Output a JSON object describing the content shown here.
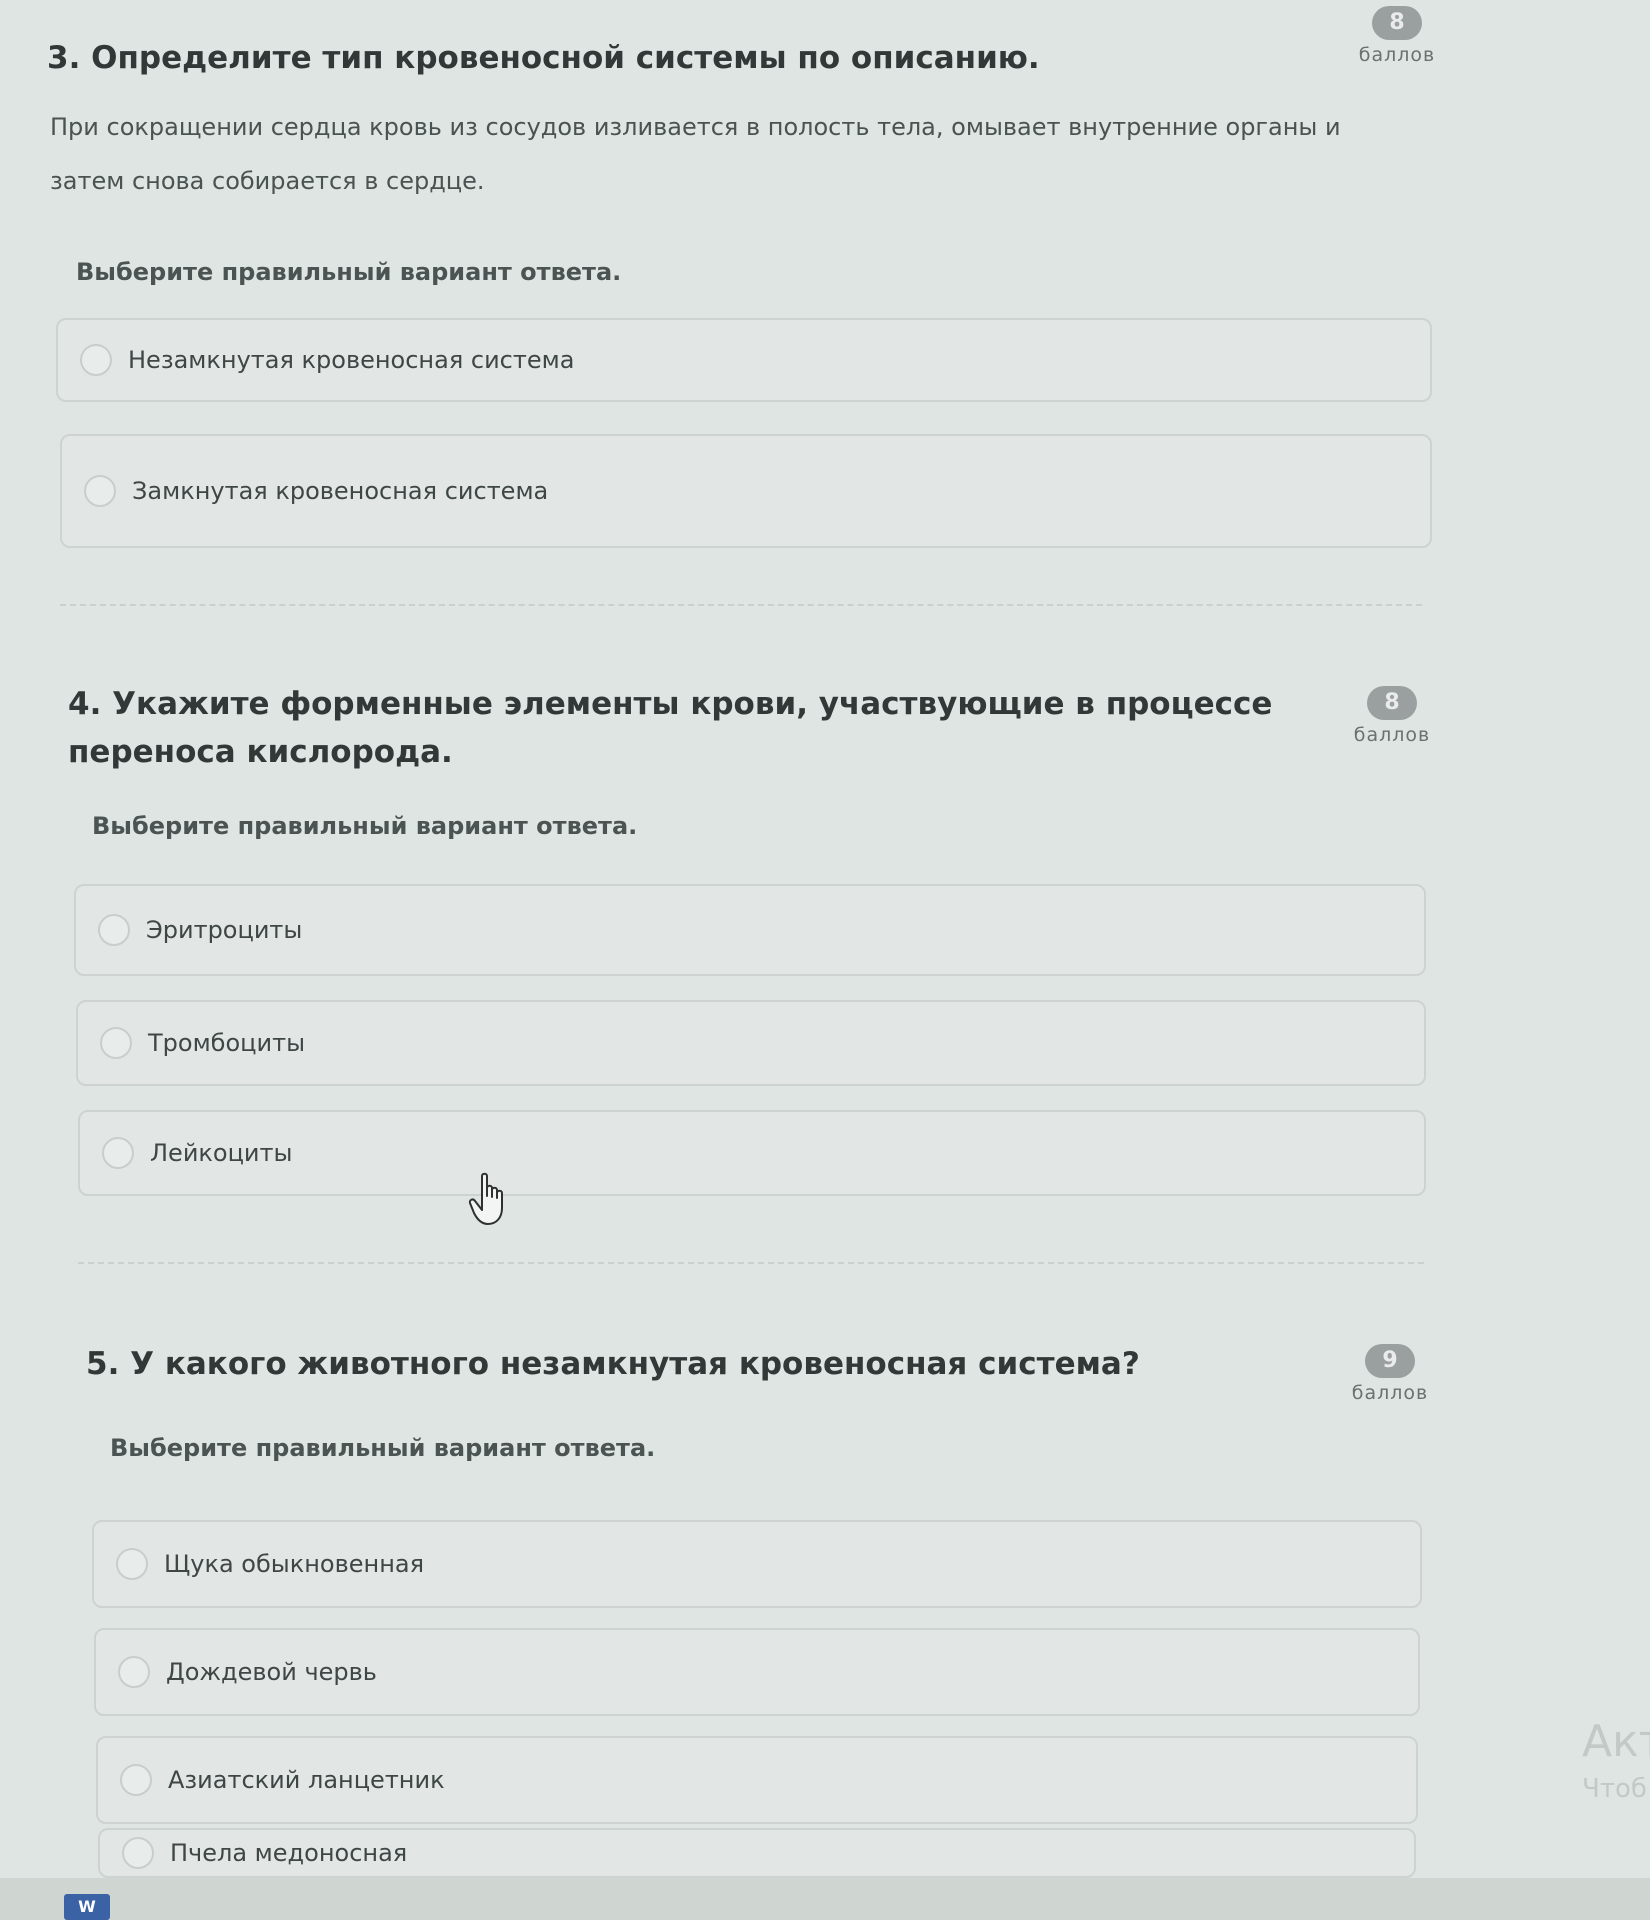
{
  "questions": [
    {
      "title": "3. Определите тип кровеносной системы по описанию.",
      "description": "При сокращении сердца кровь из сосудов изливается в полость тела, омывает внутренние органы и затем снова собирается в сердце.",
      "instruction": "Выберите правильный вариант ответа.",
      "score": "8",
      "score_label": "баллов",
      "options": [
        "Незамкнутая кровеносная система",
        "Замкнутая кровеносная система"
      ]
    },
    {
      "title": "4. Укажите форменные элементы крови, участвующие в процессе переноса кислорода.",
      "instruction": "Выберите правильный вариант ответа.",
      "score": "8",
      "score_label": "баллов",
      "options": [
        "Эритроциты",
        "Тромбоциты",
        "Лейкоциты"
      ]
    },
    {
      "title": "5. У какого животного незамкнутая кровеносная система?",
      "instruction": "Выберите правильный вариант ответа.",
      "score": "9",
      "score_label": "баллов",
      "options": [
        "Щука обыкновенная",
        "Дождевой червь",
        "Азиатский ланцетник",
        "Пчела медоносная"
      ]
    }
  ],
  "watermark": {
    "line1": "Акт",
    "line2": "Чтоб"
  },
  "icons": {
    "cursor": "hand-pointer-icon",
    "taskbar_app": "word-icon"
  },
  "taskbar": {
    "word_label": "W"
  }
}
